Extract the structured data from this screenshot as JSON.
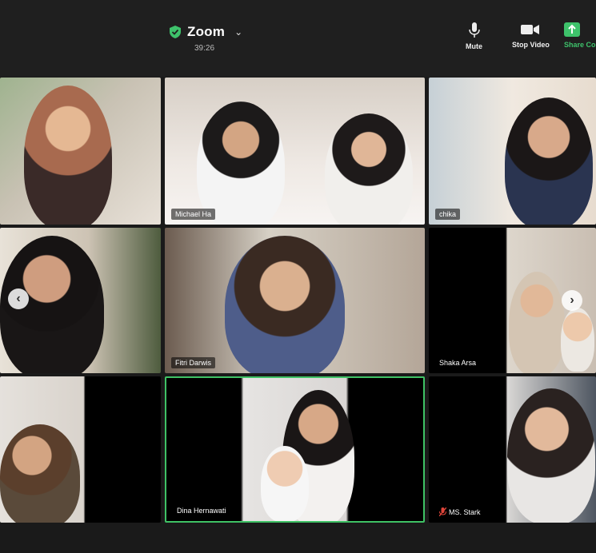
{
  "header": {
    "app_title": "Zoom",
    "timer": "39:26",
    "controls": {
      "mute_label": "Mute",
      "video_label": "Stop Video",
      "share_label": "Share Co"
    }
  },
  "participants": [
    {
      "name": ""
    },
    {
      "name": "Michael Ha"
    },
    {
      "name": "chika"
    },
    {
      "name": ""
    },
    {
      "name": "Fitri Darwis"
    },
    {
      "name": "Shaka Arsa"
    },
    {
      "name": ""
    },
    {
      "name": "Dina Hernawati"
    },
    {
      "name": "MS. Stark"
    }
  ],
  "colors": {
    "active_speaker_border": "#3fc265",
    "share_accent": "#3ec26b",
    "muted_icon": "#e0453a"
  }
}
